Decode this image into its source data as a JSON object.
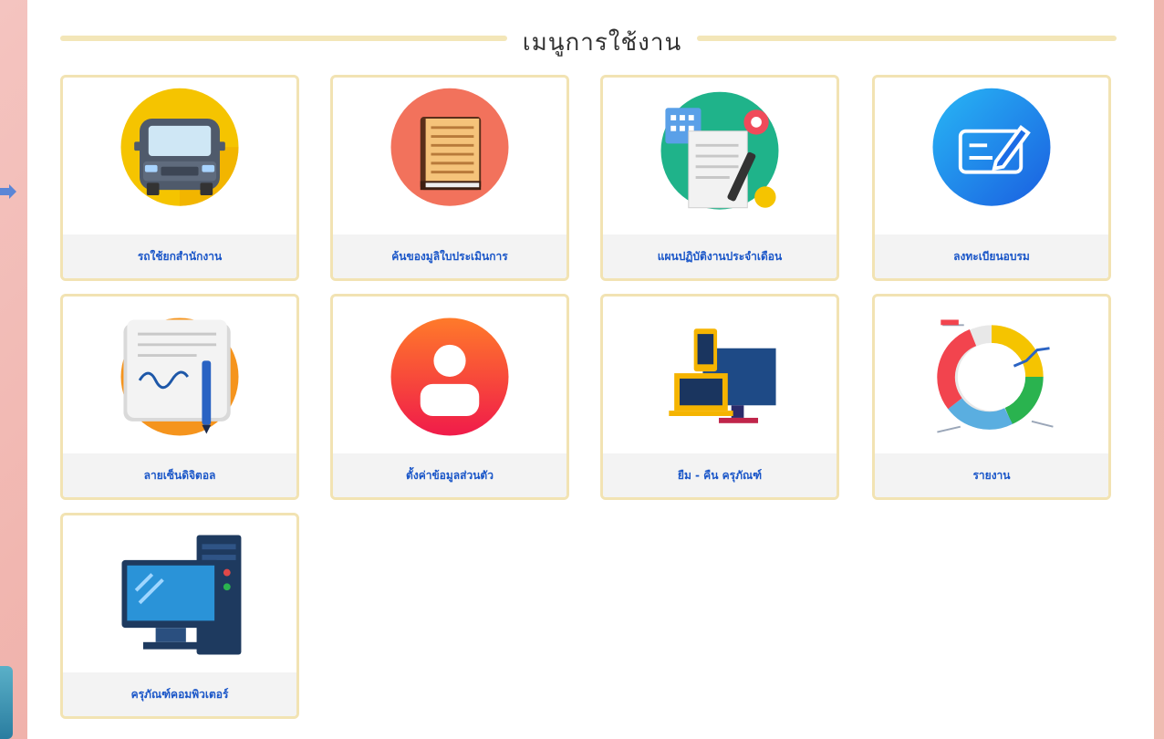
{
  "menu": {
    "title": "เมนูการใช้งาน"
  },
  "items": [
    {
      "label": "รถใช้ยกสำนักงาน",
      "icon": "car-icon"
    },
    {
      "label": "ค้นของมูลิใบประเมินการ",
      "icon": "book-icon"
    },
    {
      "label": "แผนปฏิบัติงานประจำเดือน",
      "icon": "plan-icon"
    },
    {
      "label": "ลงทะเบียนอบรม",
      "icon": "register-icon"
    },
    {
      "label": "ลายเซ็นดิจิตอล",
      "icon": "signature-icon"
    },
    {
      "label": "ตั้งค่าข้อมูลส่วนตัว",
      "icon": "profile-icon"
    },
    {
      "label": "ยืม - คืน ครุภัณฑ์",
      "icon": "device-icon"
    },
    {
      "label": "รายงาน",
      "icon": "report-icon"
    },
    {
      "label": "ครุภัณฑ์คอมพิวเตอร์",
      "icon": "computer-icon"
    }
  ]
}
